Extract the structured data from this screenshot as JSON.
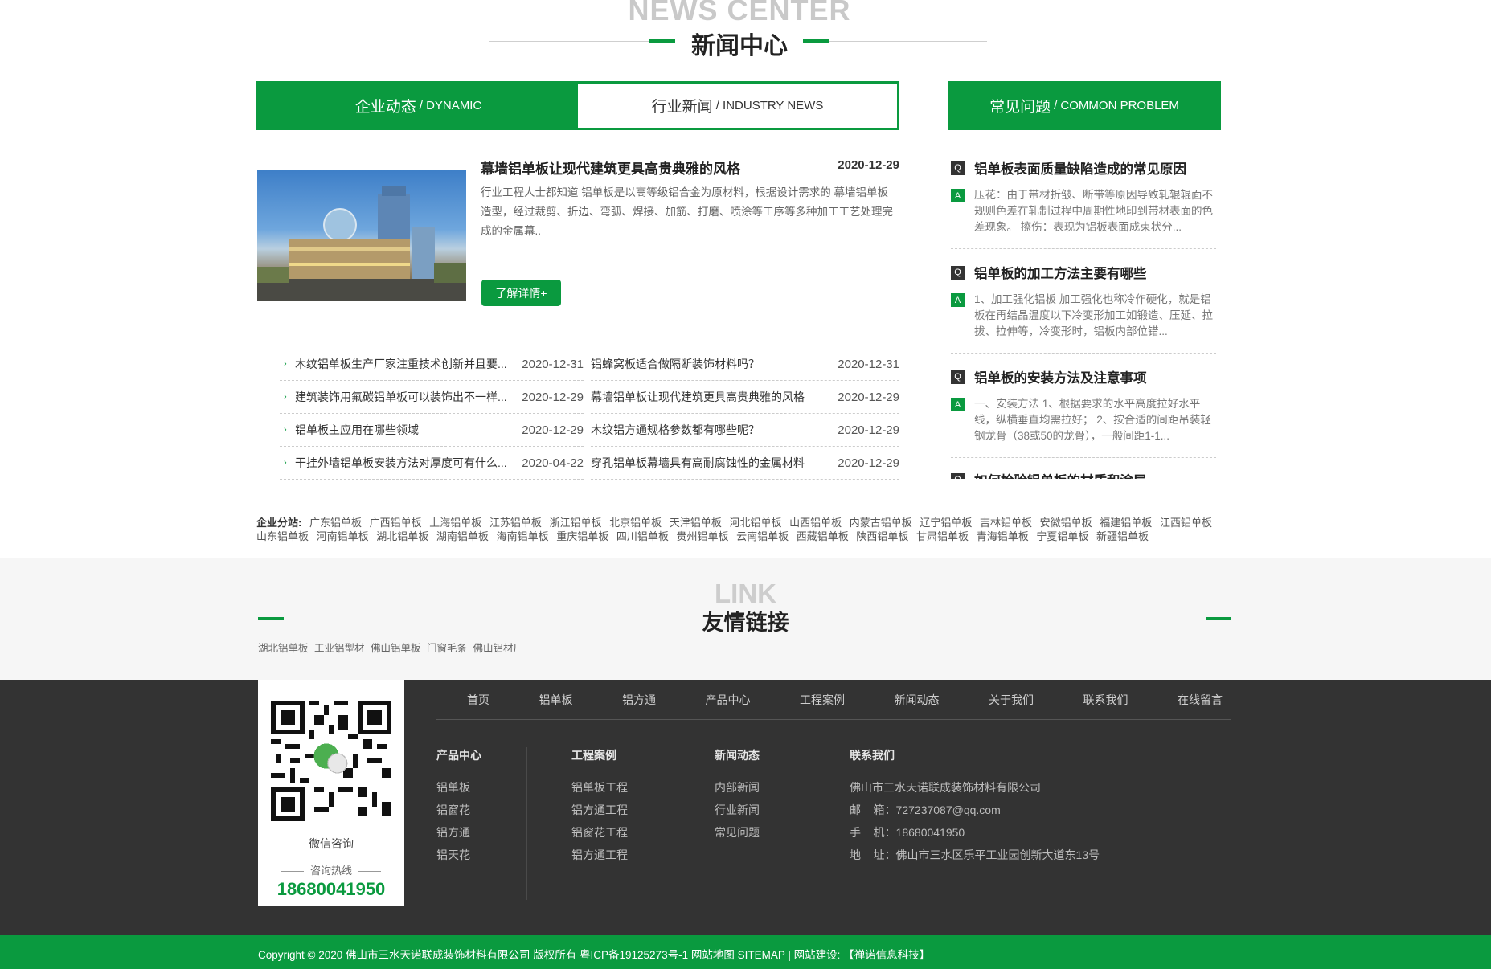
{
  "news_center": {
    "title_en": "NEWS CENTER",
    "title_cn": "新闻中心",
    "tabs": [
      {
        "label": "企业动态",
        "sub": "/ DYNAMIC"
      },
      {
        "label": "行业新闻",
        "sub": "/ INDUSTRY NEWS"
      }
    ],
    "featured": {
      "title": "幕墙铝单板让现代建筑更具高贵典雅的风格",
      "date": "2020-12-29",
      "summary": "行业工程人士都知道 铝单板是以高等级铝合金为原材料，根据设计需求的 幕墙铝单板 造型，经过裁剪、折边、弯弧、焊接、加筋、打磨、喷涂等工序等多种加工工艺处理完成的金属幕..",
      "button": "了解详情+"
    },
    "list_left": [
      {
        "title": "木纹铝单板生产厂家注重技术创新并且要...",
        "date": "2020-12-31"
      },
      {
        "title": "建筑装饰用氟碳铝单板可以装饰出不一样...",
        "date": "2020-12-29"
      },
      {
        "title": "铝单板主应用在哪些领域",
        "date": "2020-12-29"
      },
      {
        "title": "干挂外墙铝单板安装方法对厚度可有什么...",
        "date": "2020-04-22"
      }
    ],
    "list_right": [
      {
        "title": "铝蜂窝板适合做隔断装饰材料吗？",
        "date": "2020-12-31"
      },
      {
        "title": "幕墙铝单板让现代建筑更具高贵典雅的风格",
        "date": "2020-12-29"
      },
      {
        "title": "木纹铝方通规格参数都有哪些呢？",
        "date": "2020-12-29"
      },
      {
        "title": "穿孔铝单板幕墙具有高耐腐蚀性的金属材料",
        "date": "2020-12-29"
      }
    ]
  },
  "faq": {
    "title": "常见问题",
    "sub": "/ COMMON PROBLEM",
    "items": [
      {
        "q": "铝单板表面质量缺陷造成的常见原因",
        "a": "压花：由于带材折皱、断带等原因导致轧辊辊面不规则色差在轧制过程中周期性地印到带材表面的色差现象。 擦伤：表现为铝板表面成束状分..."
      },
      {
        "q": "铝单板的加工方法主要有哪些",
        "a": "1、加工强化铝板 加工强化也称冷作硬化，就是铝板在再结晶温度以下冷变形加工如锻造、压延、拉拔、拉伸等，冷变形时，铝板内部位错..."
      },
      {
        "q": "铝单板的安装方法及注意事项",
        "a": "一、安装方法 1、根据要求的水平高度拉好水平线，纵横垂直均需拉好； 2、按合适的间距吊装轻钢龙骨（38或50的龙骨），一般间距1-1..."
      },
      {
        "q": "如何检验铝单板的材质和涂层",
        "a": ""
      }
    ]
  },
  "branches": {
    "label": "企业分站:",
    "items": [
      "广东铝单板",
      "广西铝单板",
      "上海铝单板",
      "江苏铝单板",
      "浙江铝单板",
      "北京铝单板",
      "天津铝单板",
      "河北铝单板",
      "山西铝单板",
      "内蒙古铝单板",
      "辽宁铝单板",
      "吉林铝单板",
      "安徽铝单板",
      "福建铝单板",
      "江西铝单板",
      "山东铝单板",
      "河南铝单板",
      "湖北铝单板",
      "湖南铝单板",
      "海南铝单板",
      "重庆铝单板",
      "四川铝单板",
      "贵州铝单板",
      "云南铝单板",
      "西藏铝单板",
      "陕西铝单板",
      "甘肃铝单板",
      "青海铝单板",
      "宁夏铝单板",
      "新疆铝单板"
    ]
  },
  "links": {
    "title_en": "LINK",
    "title_cn": "友情链接",
    "items": [
      "湖北铝单板",
      "工业铝型材",
      "佛山铝单板",
      "门窗毛条",
      "佛山铝材厂"
    ]
  },
  "footer": {
    "qr_caption": "微信咨询",
    "hotline_label": "咨询热线",
    "hotline": "18680041950",
    "nav": [
      "首页",
      "铝单板",
      "铝方通",
      "产品中心",
      "工程案例",
      "新闻动态",
      "关于我们",
      "联系我们",
      "在线留言"
    ],
    "col_products": {
      "title": "产品中心",
      "items": [
        "铝单板",
        "铝窗花",
        "铝方通",
        "铝天花"
      ]
    },
    "col_cases": {
      "title": "工程案例",
      "items": [
        "铝单板工程",
        "铝方通工程",
        "铝窗花工程",
        "铝方通工程"
      ]
    },
    "col_news": {
      "title": "新闻动态",
      "items": [
        "内部新闻",
        "行业新闻",
        "常见问题"
      ]
    },
    "contact": {
      "title": "联系我们",
      "company": "佛山市三水天诺联成装饰材料有限公司",
      "email": "邮    箱：727237087@qq.com",
      "phone": "手    机：18680041950",
      "address": "地    址：佛山市三水区乐平工业园创新大道东13号"
    },
    "copyright": "Copyright © 2020 佛山市三水天诺联成装饰材料有限公司 版权所有  粤ICP备19125273号-1  网站地图  SITEMAP | 网站建设: 【禅诺信息科技】"
  },
  "colors": {
    "brand_green": "#0a9a3f",
    "footer_bg": "#333333"
  }
}
